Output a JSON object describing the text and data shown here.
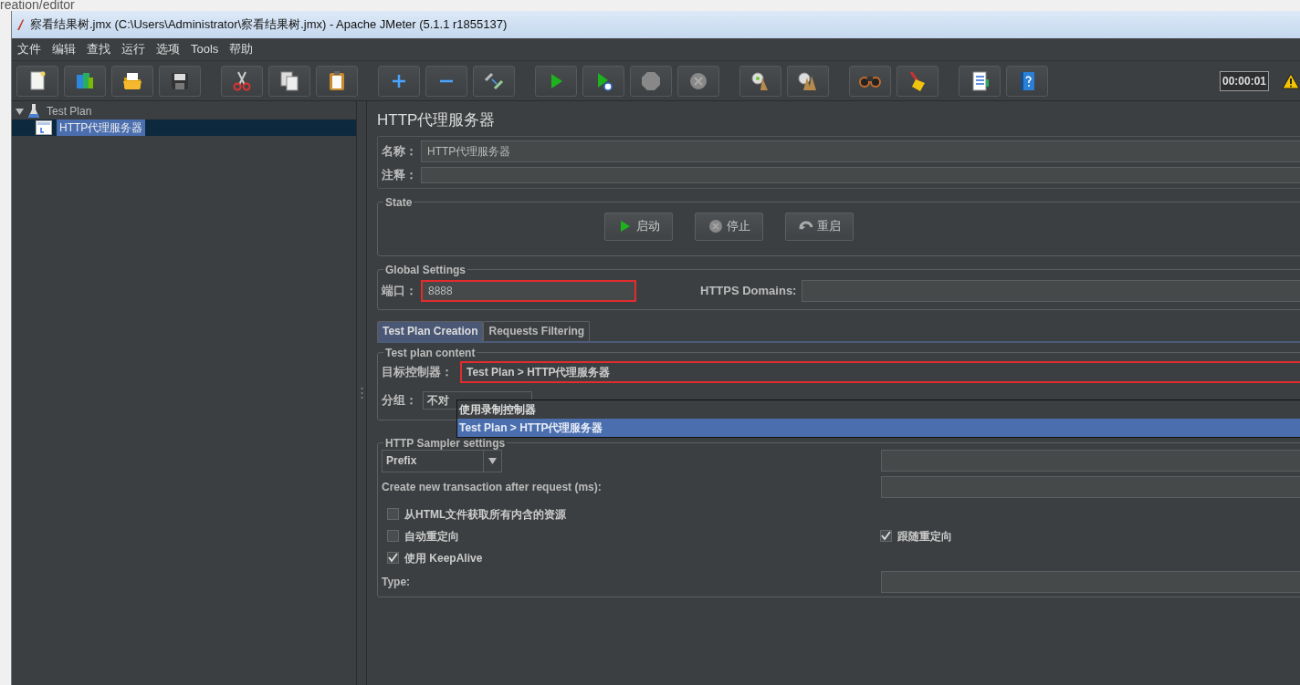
{
  "browser_fragment": "reation/editor",
  "window": {
    "title": "察看结果树.jmx (C:\\Users\\Administrator\\察看结果树.jmx) - Apache JMeter (5.1.1 r1855137)"
  },
  "menu": [
    {
      "label": "文件"
    },
    {
      "label": "编辑"
    },
    {
      "label": "查找"
    },
    {
      "label": "运行"
    },
    {
      "label": "选项"
    },
    {
      "label": "Tools"
    },
    {
      "label": "帮助"
    }
  ],
  "timer": "00:00:01",
  "tree": [
    {
      "label": "Test Plan",
      "expanded": true,
      "selected": false,
      "children": [
        {
          "label": "HTTP代理服务器",
          "selected": true
        }
      ]
    }
  ],
  "editor": {
    "title": "HTTP代理服务器",
    "name": {
      "label": "名称：",
      "value": "HTTP代理服务器"
    },
    "comment": {
      "label": "注释："
    },
    "state": {
      "legend": "State",
      "buttons": [
        {
          "label": "启动",
          "kind": "start"
        },
        {
          "label": "停止",
          "kind": "stop"
        },
        {
          "label": "重启",
          "kind": "restart"
        }
      ]
    },
    "global_settings": {
      "legend": "Global Settings",
      "port": {
        "label": "端口：",
        "value": "8888",
        "highlighted": true
      },
      "https_domains": {
        "label": "HTTPS Domains:"
      }
    },
    "tabs": [
      {
        "label": "Test Plan Creation",
        "selected": true
      },
      {
        "label": "Requests Filtering",
        "selected": false
      }
    ],
    "test_plan_content": {
      "legend": "Test plan content",
      "target": {
        "label": "目标控制器：",
        "value": "Test Plan > HTTP代理服务器",
        "highlighted": true
      },
      "grouping": {
        "label": "分组：",
        "value": "不对"
      },
      "dropdown": [
        {
          "label": "使用录制控制器",
          "selected": false
        },
        {
          "label": "Test Plan > HTTP代理服务器",
          "selected": true
        }
      ]
    },
    "sampler": {
      "legend": "HTTP Sampler settings",
      "naming": {
        "value": "Prefix"
      },
      "transaction": {
        "label": "Create new transaction after request (ms):"
      },
      "option_rows": [
        {
          "items": [
            {
              "label": "从HTML文件获取所有内含的资源",
              "checked": false
            }
          ]
        },
        {
          "items": [
            {
              "label": "自动重定向",
              "checked": false
            },
            {
              "label": "跟随重定向",
              "checked": true
            }
          ]
        },
        {
          "items": [
            {
              "label": "使用 KeepAlive",
              "checked": true
            }
          ]
        }
      ],
      "type": {
        "label": "Type:"
      }
    }
  }
}
